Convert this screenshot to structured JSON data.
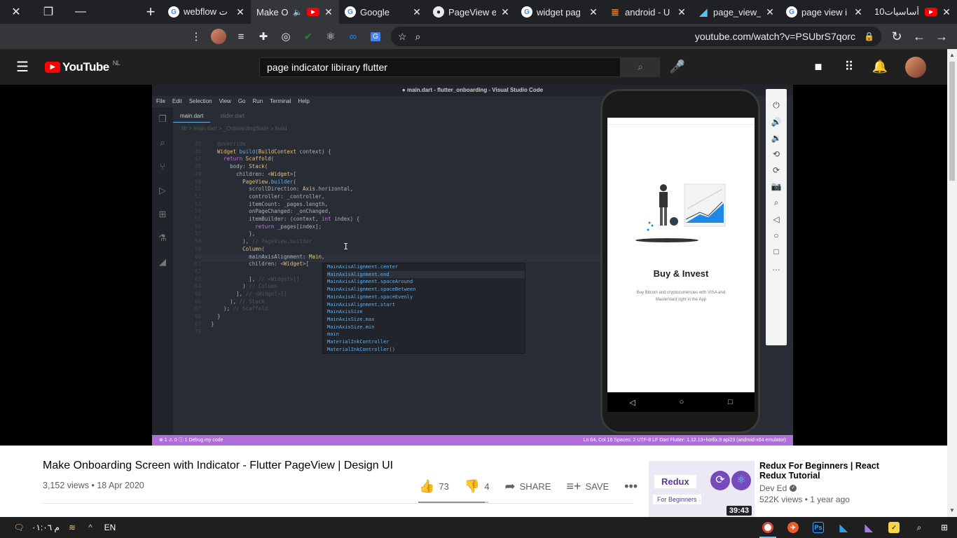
{
  "browser": {
    "tabs": [
      {
        "title": "10أساسيات",
        "icon": "youtube-icon",
        "active": false
      },
      {
        "title": "page view i",
        "icon": "google-icon",
        "active": false
      },
      {
        "title": "page_view_",
        "icon": "flutter-icon",
        "active": false
      },
      {
        "title": "android - U",
        "icon": "stackoverflow-icon",
        "active": false
      },
      {
        "title": "widget pag",
        "icon": "google-icon",
        "active": false
      },
      {
        "title": "PageView e",
        "icon": "github-icon",
        "active": false
      },
      {
        "title": "Google",
        "icon": "google-icon",
        "active": false
      },
      {
        "title": "Make O",
        "icon": "youtube-icon",
        "active": true
      },
      {
        "title": "webflow ت",
        "icon": "google-icon",
        "active": false
      }
    ],
    "url": "youtube.com/watch?v=PSUbrS7qorc"
  },
  "youtube": {
    "logo_text": "YouTube",
    "region": "NL",
    "search_query": "page indicator libirary flutter"
  },
  "video": {
    "editor_title": "● main.dart - flutter_onboarding - Visual Studio Code",
    "menu": [
      "File",
      "Edit",
      "Selection",
      "View",
      "Go",
      "Run",
      "Terminal",
      "Help"
    ],
    "editor_tabs": [
      "main.dart",
      "slider.dart"
    ],
    "breadcrumb": "lib > main.dart > _OnboardingState > build",
    "status_left": "⊗ 1 ⚠ 0 ⓘ 1   Debug my code",
    "status_right": "Ln 64, Col 16   Spaces: 2   UTF-8   LF   Dart   Flutter: 1.12.13+hotfix.9   api23 (android-x64 emulator)",
    "suggestions": [
      "MainAxisAlignment.center",
      "MainAxisAlignment.end",
      "MainAxisAlignment.spaceAround",
      "MainAxisAlignment.spaceBetween",
      "MainAxisAlignment.spaceEvenly",
      "MainAxisAlignment.start",
      "MainAxisSize",
      "MainAxisSize.max",
      "MainAxisSize.min",
      "main",
      "MaterialInkController",
      "MaterialInkController()"
    ],
    "phone_title": "Buy & Invest",
    "phone_desc": "Buy Bitcoin and cryptocurrencies with VISA and MasterVard right in the App"
  },
  "watch": {
    "title": "Make Onboarding Screen with Indicator - Flutter PageView | Design UI",
    "views": "3,152 views",
    "date": "18 Apr 2020",
    "likes": "73",
    "dislikes": "4",
    "share_label": "SHARE",
    "save_label": "SAVE",
    "like_ratio": 0.948
  },
  "related": {
    "title": "Redux For Beginners | React Redux Tutorial",
    "channel": "Dev Ed",
    "views": "522K views",
    "age": "1 year ago",
    "duration": "39:43",
    "thumb_word1": "Redux",
    "thumb_word2": "For Beginners"
  },
  "taskbar": {
    "clock": "م ٠١:٠٦",
    "lang": "EN"
  }
}
